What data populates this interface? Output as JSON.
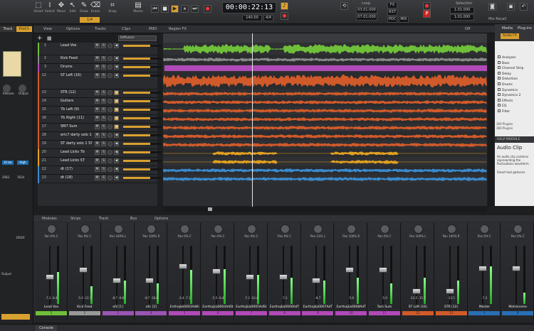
{
  "tools": [
    "Smart",
    "Select",
    "Move",
    "Edit",
    "Draw",
    "Erase",
    "Snap",
    "Marks"
  ],
  "snap_value": "1/4",
  "transport": {
    "time": "00:00:22:13",
    "tempo": "140.00",
    "meter": "4/4"
  },
  "loop": {
    "label": "Loop",
    "start": "03:01:000",
    "end": "07:01:000"
  },
  "fx_labels": [
    "FX",
    "RST",
    "PDC",
    "MIX"
  ],
  "selection": {
    "label": "Selection",
    "start": "1:01:000",
    "end": "1:01:000"
  },
  "mix_recall": "Mix Recall",
  "left_pane": {
    "tabs": [
      "Track",
      "ProCh"
    ],
    "labels": [
      "Release",
      "Output",
      "Sends",
      "Output",
      "Output"
    ],
    "values": [
      "2083",
      "1624",
      "10024"
    ]
  },
  "trackview_menu": [
    "View",
    "Options",
    "Tracks",
    "Clips",
    "MIDI",
    "Region FX"
  ],
  "trackview_tail": [
    "Diffusion",
    "Off"
  ],
  "tracks": [
    {
      "num": "1",
      "name": "Lead Vox",
      "vol": "-3.2",
      "color": "#6fbf3a"
    },
    {
      "num": "2",
      "name": "Kick Feed",
      "vol": "-5.0",
      "color": "#888"
    },
    {
      "num": "3",
      "name": "Drums",
      "vol": "",
      "color": "#b04ab8"
    },
    {
      "num": "12",
      "name": "ST Left (16)",
      "vol": "-12.0",
      "color": "#d05a2a"
    },
    {
      "num": "13",
      "name": "STR (12)",
      "vol": "-12.1",
      "color": "#d05a2a"
    },
    {
      "num": "14",
      "name": "Guitars",
      "vol": "-18.2",
      "color": "#d05a2a"
    },
    {
      "num": "15",
      "name": "7b Left (9)",
      "vol": "-15.2",
      "color": "#d05a2a"
    },
    {
      "num": "16",
      "name": "7b Right (11)",
      "vol": "-16.4",
      "color": "#d05a2a"
    },
    {
      "num": "17",
      "name": "SM7 Sum",
      "vol": "-16.0",
      "color": "#d05a2a"
    },
    {
      "num": "18",
      "name": "eric7 darty solo 1",
      "vol": "-17.2",
      "color": "#d05a2a"
    },
    {
      "num": "19",
      "name": "ST darty solo 1 ST",
      "vol": "-17.2",
      "color": "#d05a2a"
    },
    {
      "num": "20",
      "name": "Lead Licks 7b",
      "vol": "-15.4",
      "color": "#e0a020"
    },
    {
      "num": "21",
      "name": "Lead Licks ST",
      "vol": "-15.4",
      "color": "#e0a020"
    },
    {
      "num": "22",
      "name": "dt (17)",
      "vol": "-17.1",
      "color": "#3a8acd"
    },
    {
      "num": "23",
      "name": "dt (18)",
      "vol": "-17.1",
      "color": "#3a8acd"
    }
  ],
  "clip_label": "Clips",
  "fx_button": "FX (2)",
  "browser": {
    "tabs": [
      "Media",
      "Plug-ins"
    ],
    "button": "Audio FX",
    "items": [
      "Analyzer",
      "Bass",
      "Channel Strip",
      "Delay",
      "Distortion",
      "Drums",
      "Dynamics",
      "Dynamics 2",
      "Effects",
      "EQ",
      "Filter"
    ],
    "counts": [
      "360 Plugins",
      "360 Plugins"
    ],
    "help_title": "HELP MODULE",
    "help_heading": "Audio Clip",
    "help_text": "An audio clip contains representing the fluctuations waveform.",
    "help_sub": "Smart tool gestures"
  },
  "mixer_menu": [
    "Modules",
    "Strips",
    "Track",
    "Bus",
    "Options"
  ],
  "strips": [
    {
      "name": "Lead Vox",
      "num": "1",
      "pan": "0% C",
      "db": "-7.2   -8.4",
      "color": "#6fbf3a",
      "fader": 40,
      "meter": 55
    },
    {
      "name": "Kick Feed",
      "num": "2",
      "pan": "0% C",
      "db": "-5.0  -12.1",
      "color": "#999",
      "fader": 30,
      "meter": 30
    },
    {
      "name": "ohl [1]",
      "num": "3",
      "pan": "100% L",
      "db": "-8.7   -9.8",
      "color": "#9a55b4",
      "fader": 45,
      "meter": 40
    },
    {
      "name": "ohr [2]",
      "num": "4",
      "pan": "100% R",
      "db": "-8.7  -18.8",
      "color": "#9a55b4",
      "fader": 45,
      "meter": 35
    },
    {
      "name": "Enthojke0003AdKi",
      "num": "5",
      "pan": "0% C",
      "db": "-2.4   -7.1",
      "color": "#b04ab8",
      "fader": 25,
      "meter": 58
    },
    {
      "name": "Earthojka0004AdSt",
      "num": "6",
      "pan": "0% C",
      "db": "-5.5   -6.4",
      "color": "#b04ab8",
      "fader": 32,
      "meter": 60
    },
    {
      "name": "Earthojka0005AdSt",
      "num": "7",
      "pan": "0% C",
      "db": "-7.2  -10.4",
      "color": "#b04ab8",
      "fader": 40,
      "meter": 50
    },
    {
      "name": "Earthojka0006AdT",
      "num": "8",
      "pan": "0% C",
      "db": "-7.2",
      "color": "#b04ab8",
      "fader": 40,
      "meter": 45
    },
    {
      "name": "Earthojka0007AdT",
      "num": "9",
      "pan": "13% L",
      "db": "-8.7",
      "color": "#b04ab8",
      "fader": 45,
      "meter": 40
    },
    {
      "name": "Earthojka0008AdT",
      "num": "10",
      "pan": "100% R",
      "db": "-5.0",
      "color": "#b04ab8",
      "fader": 30,
      "meter": 45
    },
    {
      "name": "Tom Sum",
      "num": "11",
      "pan": "0% C",
      "db": "-5.0",
      "color": "#b04ab8",
      "fader": 30,
      "meter": 35
    },
    {
      "name": "ST Left (16)",
      "num": "12",
      "pan": "100% L",
      "db": "-13.5  -15.7",
      "color": "#d05a2a",
      "fader": 60,
      "meter": 45
    },
    {
      "name": "STR (12)",
      "num": "13",
      "pan": "100% R",
      "db": "-13.5",
      "color": "#d05a2a",
      "fader": 60,
      "meter": 40
    },
    {
      "name": "Master",
      "num": "A",
      "pan": "0% C",
      "db": "-7.2",
      "color": "#2a6fb4",
      "fader": 28,
      "meter": 65
    },
    {
      "name": "Metronome",
      "num": "B",
      "pan": "0% C",
      "db": "",
      "color": "#2a6fb4",
      "fader": 28,
      "meter": 20
    }
  ],
  "bottom_tab": "Console"
}
